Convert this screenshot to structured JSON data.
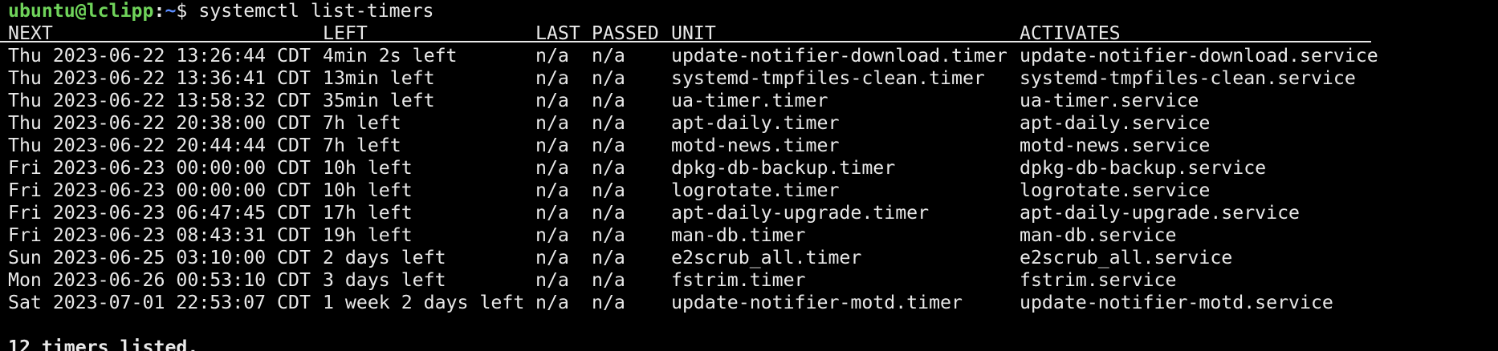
{
  "prompt": {
    "user_host": "ubuntu@lclipp",
    "separator": ":",
    "path": "~",
    "dollar": "$",
    "command": " systemctl list-timers"
  },
  "headers": {
    "next": "NEXT",
    "left": "LEFT",
    "last": "LAST",
    "passed": "PASSED",
    "unit": "UNIT",
    "activates": "ACTIVATES"
  },
  "rows": [
    {
      "next": "Thu 2023-06-22 13:26:44 CDT",
      "left": "4min 2s left",
      "last": "n/a",
      "passed": "n/a",
      "unit": "update-notifier-download.timer",
      "activates": "update-notifier-download.service"
    },
    {
      "next": "Thu 2023-06-22 13:36:41 CDT",
      "left": "13min left",
      "last": "n/a",
      "passed": "n/a",
      "unit": "systemd-tmpfiles-clean.timer",
      "activates": "systemd-tmpfiles-clean.service"
    },
    {
      "next": "Thu 2023-06-22 13:58:32 CDT",
      "left": "35min left",
      "last": "n/a",
      "passed": "n/a",
      "unit": "ua-timer.timer",
      "activates": "ua-timer.service"
    },
    {
      "next": "Thu 2023-06-22 20:38:00 CDT",
      "left": "7h left",
      "last": "n/a",
      "passed": "n/a",
      "unit": "apt-daily.timer",
      "activates": "apt-daily.service"
    },
    {
      "next": "Thu 2023-06-22 20:44:44 CDT",
      "left": "7h left",
      "last": "n/a",
      "passed": "n/a",
      "unit": "motd-news.timer",
      "activates": "motd-news.service"
    },
    {
      "next": "Fri 2023-06-23 00:00:00 CDT",
      "left": "10h left",
      "last": "n/a",
      "passed": "n/a",
      "unit": "dpkg-db-backup.timer",
      "activates": "dpkg-db-backup.service"
    },
    {
      "next": "Fri 2023-06-23 00:00:00 CDT",
      "left": "10h left",
      "last": "n/a",
      "passed": "n/a",
      "unit": "logrotate.timer",
      "activates": "logrotate.service"
    },
    {
      "next": "Fri 2023-06-23 06:47:45 CDT",
      "left": "17h left",
      "last": "n/a",
      "passed": "n/a",
      "unit": "apt-daily-upgrade.timer",
      "activates": "apt-daily-upgrade.service"
    },
    {
      "next": "Fri 2023-06-23 08:43:31 CDT",
      "left": "19h left",
      "last": "n/a",
      "passed": "n/a",
      "unit": "man-db.timer",
      "activates": "man-db.service"
    },
    {
      "next": "Sun 2023-06-25 03:10:00 CDT",
      "left": "2 days left",
      "last": "n/a",
      "passed": "n/a",
      "unit": "e2scrub_all.timer",
      "activates": "e2scrub_all.service"
    },
    {
      "next": "Mon 2023-06-26 00:53:10 CDT",
      "left": "3 days left",
      "last": "n/a",
      "passed": "n/a",
      "unit": "fstrim.timer",
      "activates": "fstrim.service"
    },
    {
      "next": "Sat 2023-07-01 22:53:07 CDT",
      "left": "1 week 2 days left",
      "last": "n/a",
      "passed": "n/a",
      "unit": "update-notifier-motd.timer",
      "activates": "update-notifier-motd.service"
    }
  ],
  "summary": "12 timers listed.",
  "colors": {
    "background": "#000000",
    "foreground": "#e8e8e8",
    "user_host": "#6fd35a",
    "path": "#5b8cff"
  }
}
